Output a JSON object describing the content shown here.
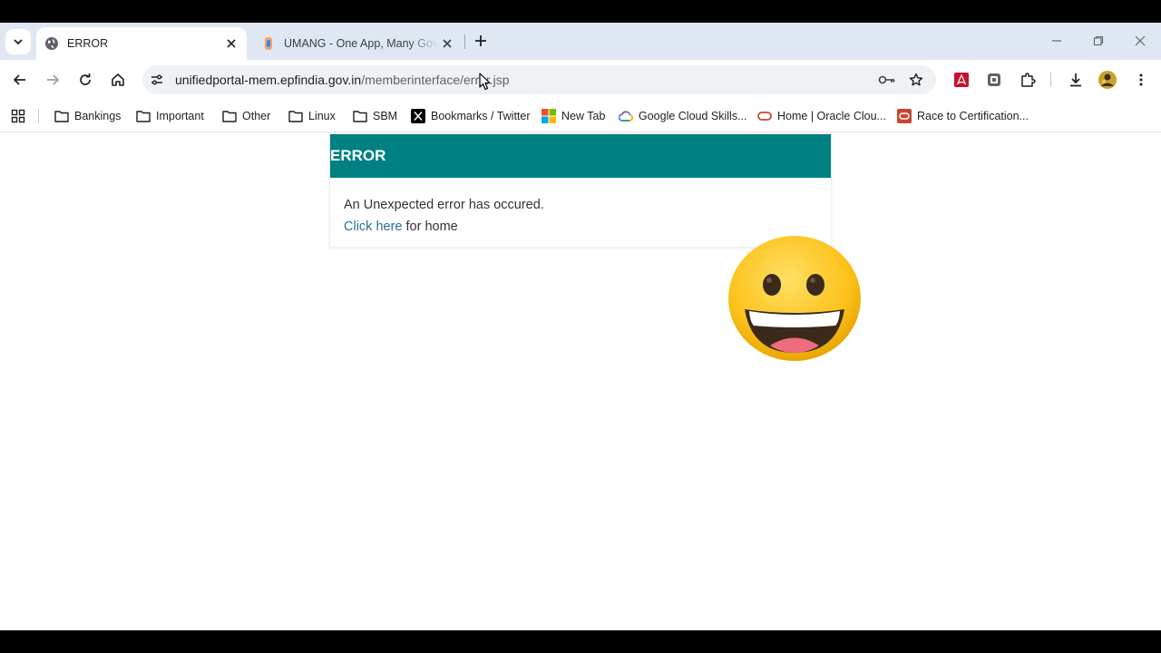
{
  "tabs": [
    {
      "title": "ERROR",
      "active": true,
      "favicon": "globe-icon"
    },
    {
      "title": "UMANG - One App, Many Government Services",
      "active": false,
      "favicon": "umang-icon"
    }
  ],
  "omnibox": {
    "domain": "unifiedportal-mem.epfindia.gov.in",
    "path": "/memberinterface/error.jsp"
  },
  "bookmarks": [
    {
      "label": "Bankings",
      "icon": "folder-icon"
    },
    {
      "label": "Important",
      "icon": "folder-icon"
    },
    {
      "label": "Other",
      "icon": "folder-icon"
    },
    {
      "label": "Linux",
      "icon": "folder-icon"
    },
    {
      "label": "SBM",
      "icon": "folder-icon"
    },
    {
      "label": "Bookmarks / Twitter",
      "icon": "x-logo-icon"
    },
    {
      "label": "New Tab",
      "icon": "microsoft-logo-icon"
    },
    {
      "label": "Google Cloud Skills...",
      "icon": "google-cloud-icon"
    },
    {
      "label": "Home | Oracle Clou...",
      "icon": "oracle-icon"
    },
    {
      "label": "Race to Certification...",
      "icon": "oracle-red-icon"
    }
  ],
  "page": {
    "header": "ERROR",
    "message": "An Unexpected error has occured.",
    "link_text": "Click here",
    "link_suffix": " for home"
  },
  "colors": {
    "header_bg": "#008080",
    "link": "#2a6f97",
    "tabstrip": "#dfe8f2"
  }
}
